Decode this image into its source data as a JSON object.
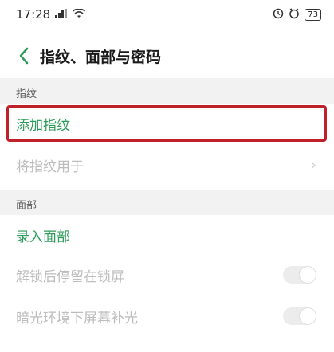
{
  "status_bar": {
    "time": "17:28",
    "signal_icon": "signal-icon",
    "wifi_icon": "wifi-icon",
    "alarm_icon": "alarm-icon",
    "battery": "73"
  },
  "header": {
    "title": "指纹、面部与密码",
    "back_icon": "chevron-left-icon"
  },
  "sections": {
    "fingerprint": {
      "label": "指纹",
      "add": "添加指纹",
      "use_for": "将指纹用于"
    },
    "face": {
      "label": "面部",
      "enroll": "录入面部",
      "stay_on_lock": "解锁后停留在锁屏",
      "fill_light": "暗光环境下屏幕补光"
    }
  },
  "colors": {
    "accent": "#2e9c5a",
    "highlight": "#c0202a",
    "disabled_text": "#bdbdbd"
  }
}
